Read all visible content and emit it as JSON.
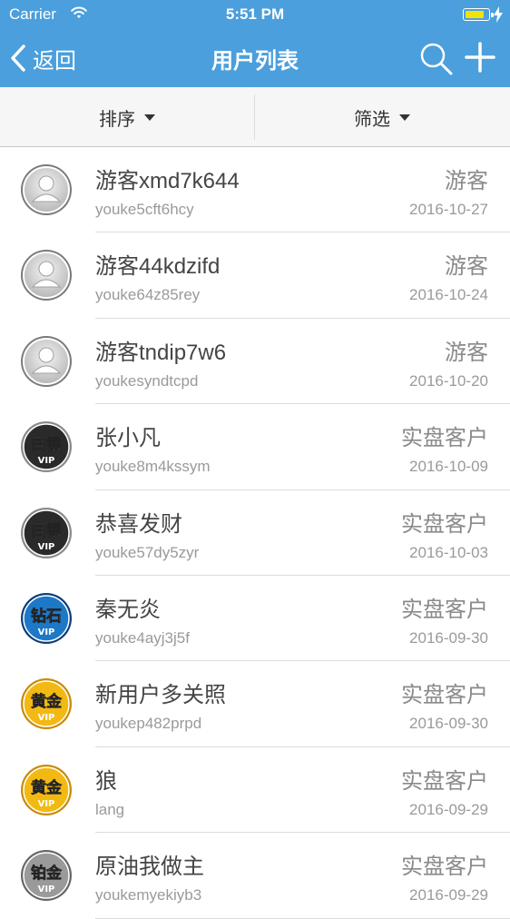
{
  "status_bar": {
    "carrier": "Carrier",
    "time": "5:51 PM"
  },
  "nav": {
    "back_label": "返回",
    "title": "用户列表"
  },
  "filters": {
    "sort_label": "排序",
    "filter_label": "筛选"
  },
  "icons": {
    "back": "chevron-left-icon",
    "search": "search-icon",
    "add": "plus-icon",
    "dropdown": "caret-down-icon"
  },
  "colors": {
    "nav_bar": "#4b9fdc",
    "battery": "#f1e20a"
  },
  "badges": {
    "guest": {
      "kind": "guest",
      "text": ""
    },
    "silver": {
      "kind": "vip",
      "text": "白银",
      "sub": "VIP",
      "bg": "#2a2a2a",
      "rim": "#8a8a8a"
    },
    "diamond": {
      "kind": "vip",
      "text": "钻石",
      "sub": "VIP",
      "bg": "#1d78c8",
      "rim": "#0b3d7a"
    },
    "gold": {
      "kind": "vip",
      "text": "黄金",
      "sub": "VIP",
      "bg": "#f3b913",
      "rim": "#c98a06"
    },
    "platinum": {
      "kind": "vip",
      "text": "铂金",
      "sub": "VIP",
      "bg": "#9a9a9a",
      "rim": "#666666"
    }
  },
  "users": [
    {
      "name": "游客xmd7k644",
      "account": "youke5cft6hcy",
      "type": "游客",
      "date": "2016-10-27",
      "badge": "guest"
    },
    {
      "name": "游客44kdzifd",
      "account": "youke64z85rey",
      "type": "游客",
      "date": "2016-10-24",
      "badge": "guest"
    },
    {
      "name": "游客tndip7w6",
      "account": "youkesyndtcpd",
      "type": "游客",
      "date": "2016-10-20",
      "badge": "guest"
    },
    {
      "name": "张小凡",
      "account": "youke8m4kssym",
      "type": "实盘客户",
      "date": "2016-10-09",
      "badge": "silver"
    },
    {
      "name": "恭喜发财",
      "account": "youke57dy5zyr",
      "type": "实盘客户",
      "date": "2016-10-03",
      "badge": "silver"
    },
    {
      "name": "秦无炎",
      "account": "youke4ayj3j5f",
      "type": "实盘客户",
      "date": "2016-09-30",
      "badge": "diamond"
    },
    {
      "name": "新用户多关照",
      "account": "youkep482prpd",
      "type": "实盘客户",
      "date": "2016-09-30",
      "badge": "gold"
    },
    {
      "name": "狼",
      "account": "lang",
      "type": "实盘客户",
      "date": "2016-09-29",
      "badge": "gold"
    },
    {
      "name": "原油我做主",
      "account": "youkemyekiyb3",
      "type": "实盘客户",
      "date": "2016-09-29",
      "badge": "platinum"
    }
  ]
}
